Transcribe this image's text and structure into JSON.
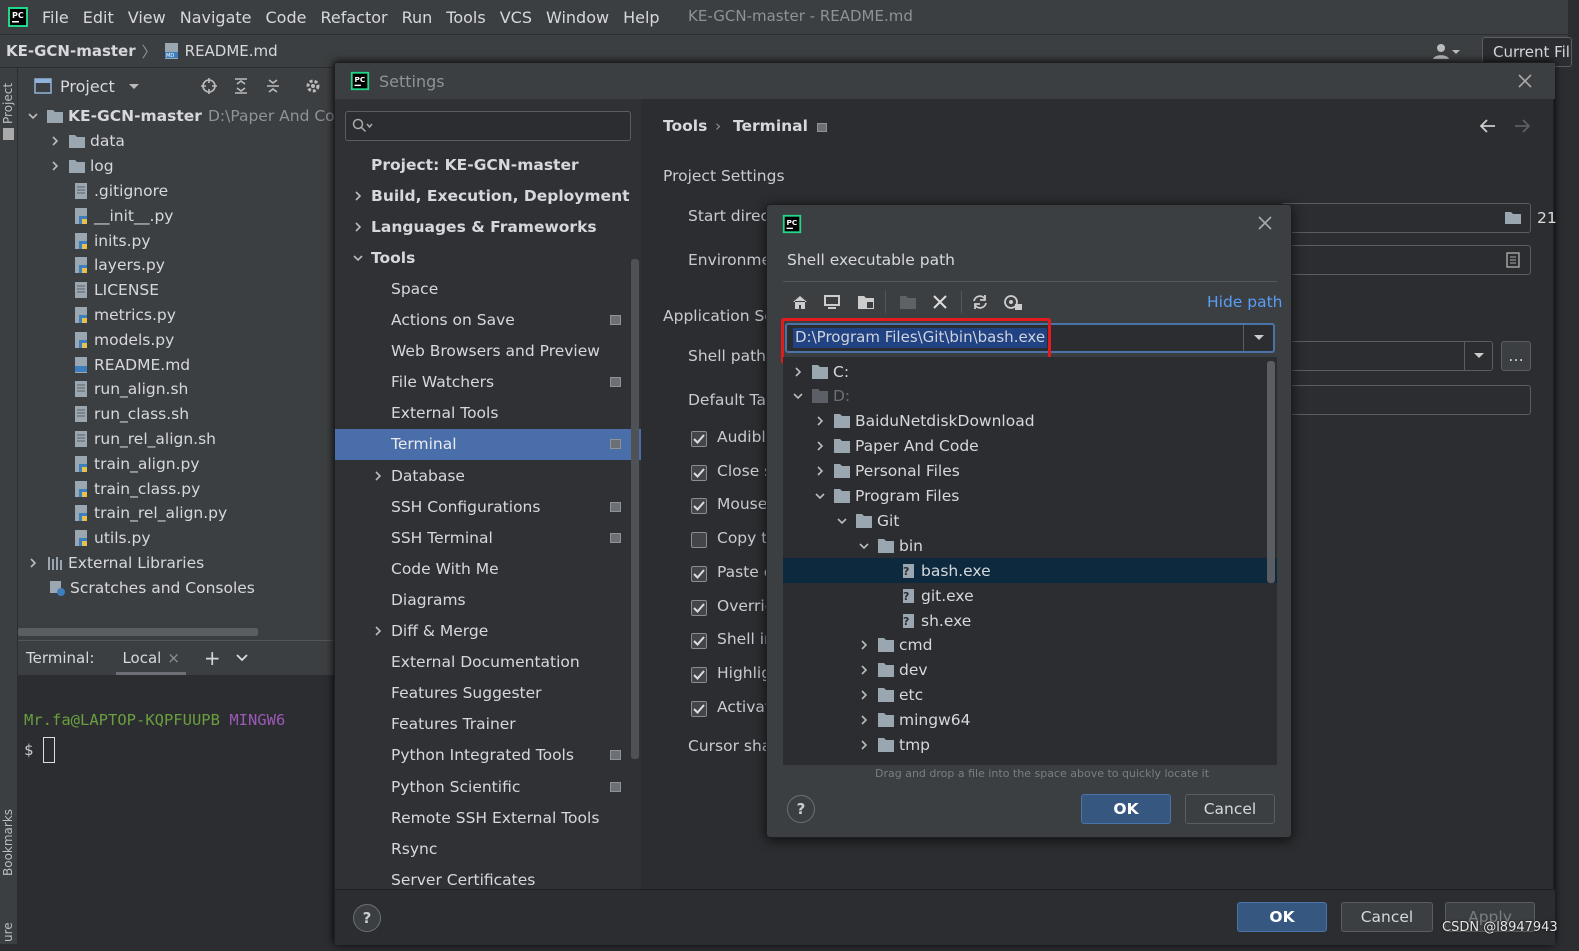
{
  "menubar": {
    "items": [
      "File",
      "Edit",
      "View",
      "Navigate",
      "Code",
      "Refactor",
      "Run",
      "Tools",
      "VCS",
      "Window",
      "Help"
    ],
    "window_title": "KE-GCN-master - README.md"
  },
  "navbar": {
    "project": "KE-GCN-master",
    "file": "README.md",
    "current_file": "Current Fil"
  },
  "leftstrip": {
    "project_tab": "Project",
    "bookmarks_tab": "Bookmarks",
    "structure_tab": "ure"
  },
  "project_panel": {
    "title": "Project",
    "root_name": "KE-GCN-master",
    "root_path": "D:\\Paper And Code",
    "folders": [
      "data",
      "log"
    ],
    "files": [
      ".gitignore",
      "__init__.py",
      "inits.py",
      "layers.py",
      "LICENSE",
      "metrics.py",
      "models.py",
      "README.md",
      "run_align.sh",
      "run_class.sh",
      "run_rel_align.sh",
      "train_align.py",
      "train_class.py",
      "train_rel_align.py",
      "utils.py"
    ],
    "external": "External Libraries",
    "scratches": "Scratches and Consoles"
  },
  "terminal": {
    "label": "Terminal:",
    "tab": "Local",
    "prompt_user": "Mr.fa@LAPTOP-KQPFUUPB",
    "prompt_env": "MINGW6",
    "prompt_symbol": "$"
  },
  "settings": {
    "title": "Settings",
    "search_placeholder": "",
    "breadcrumb": {
      "root": "Tools",
      "leaf": "Terminal"
    },
    "nav": [
      {
        "label": "Project: KE-GCN-master",
        "bold": true
      },
      {
        "label": "Build, Execution, Deployment",
        "bold": true
      },
      {
        "label": "Languages & Frameworks",
        "bold": true
      },
      {
        "label": "Tools",
        "bold": true
      },
      {
        "label": "Space"
      },
      {
        "label": "Actions on Save"
      },
      {
        "label": "Web Browsers and Preview"
      },
      {
        "label": "File Watchers"
      },
      {
        "label": "External Tools"
      },
      {
        "label": "Terminal"
      },
      {
        "label": "Database"
      },
      {
        "label": "SSH Configurations"
      },
      {
        "label": "SSH Terminal"
      },
      {
        "label": "Code With Me"
      },
      {
        "label": "Diagrams"
      },
      {
        "label": "Diff & Merge"
      },
      {
        "label": "External Documentation"
      },
      {
        "label": "Features Suggester"
      },
      {
        "label": "Features Trainer"
      },
      {
        "label": "Python Integrated Tools"
      },
      {
        "label": "Python Scientific"
      },
      {
        "label": "Remote SSH External Tools"
      },
      {
        "label": "Rsync"
      },
      {
        "label": "Server Certificates"
      }
    ],
    "right": {
      "project_settings": "Project Settings",
      "start_dir": "Start direct",
      "env_vars": "Environmen",
      "app_settings": "Application Se",
      "shell_path": "Shell path:",
      "default_tab": "Default Tab",
      "cursor_shape": "Cursor shap",
      "side_num": "21",
      "checkboxes": [
        {
          "label": "Audible",
          "checked": true
        },
        {
          "label": "Close s",
          "checked": true
        },
        {
          "label": "Mouse",
          "checked": true
        },
        {
          "label": "Copy t",
          "checked": false
        },
        {
          "label": "Paste c",
          "checked": true
        },
        {
          "label": "Overric",
          "checked": true
        },
        {
          "label": "Shell in",
          "checked": true
        },
        {
          "label": "Highlig",
          "checked": true
        },
        {
          "label": "Activat",
          "checked": true
        }
      ]
    },
    "buttons": {
      "ok": "OK",
      "cancel": "Cancel",
      "apply": "Apply",
      "help": "?"
    }
  },
  "shell_dialog": {
    "title": "Shell executable path",
    "hide_path": "Hide path",
    "path_value": "D:\\Program Files\\Git\\bin\\bash.exe",
    "tree": [
      {
        "label": "C:",
        "level": 0,
        "type": "folder",
        "expanded": false
      },
      {
        "label": "D:",
        "level": 0,
        "type": "folder",
        "expanded": true,
        "dim": true
      },
      {
        "label": "BaiduNetdiskDownload",
        "level": 1,
        "type": "folder",
        "expanded": false
      },
      {
        "label": "Paper And Code",
        "level": 1,
        "type": "folder",
        "expanded": false
      },
      {
        "label": "Personal Files",
        "level": 1,
        "type": "folder",
        "expanded": false
      },
      {
        "label": "Program Files",
        "level": 1,
        "type": "folder",
        "expanded": true
      },
      {
        "label": "Git",
        "level": 2,
        "type": "folder",
        "expanded": true
      },
      {
        "label": "bin",
        "level": 3,
        "type": "folder",
        "expanded": true
      },
      {
        "label": "bash.exe",
        "level": 4,
        "type": "file",
        "selected": true
      },
      {
        "label": "git.exe",
        "level": 4,
        "type": "file"
      },
      {
        "label": "sh.exe",
        "level": 4,
        "type": "file"
      },
      {
        "label": "cmd",
        "level": 3,
        "type": "folder",
        "expanded": false
      },
      {
        "label": "dev",
        "level": 3,
        "type": "folder",
        "expanded": false
      },
      {
        "label": "etc",
        "level": 3,
        "type": "folder",
        "expanded": false
      },
      {
        "label": "mingw64",
        "level": 3,
        "type": "folder",
        "expanded": false
      },
      {
        "label": "tmp",
        "level": 3,
        "type": "folder",
        "expanded": false
      }
    ],
    "drag_hint": "Drag and drop a file into the space above to quickly locate it",
    "ok": "OK",
    "cancel": "Cancel",
    "help": "?"
  },
  "watermark": "CSDN @l8947943",
  "colors": {
    "accent": "#4a6eaa",
    "selection": "#0d293e",
    "highlight_box": "#e21c1c",
    "prompt_user": "#6a9e3f",
    "prompt_env": "#9b59b6"
  }
}
